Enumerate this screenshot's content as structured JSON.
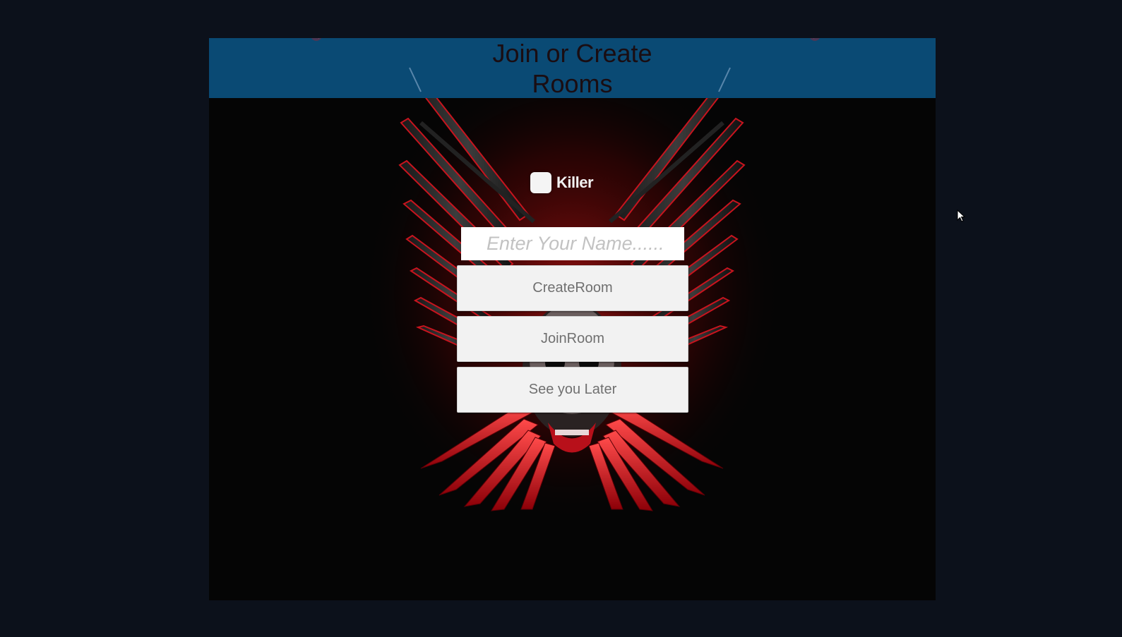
{
  "header": {
    "title": "Join or Create Rooms"
  },
  "toggle": {
    "label": "Killer",
    "checked": false
  },
  "name_input": {
    "placeholder": "Enter Your Name......",
    "value": ""
  },
  "buttons": {
    "create": "CreateRoom",
    "join": "JoinRoom",
    "quit": "See you Later"
  },
  "icons": {
    "emblem": "skull-weapons-wings-emblem",
    "cursor": "mouse-pointer-icon"
  },
  "colors": {
    "header_bar": "#0a4a74",
    "panel_bg": "#050505",
    "outer_bg": "#0c111b",
    "emblem_red": "#c8141e"
  }
}
